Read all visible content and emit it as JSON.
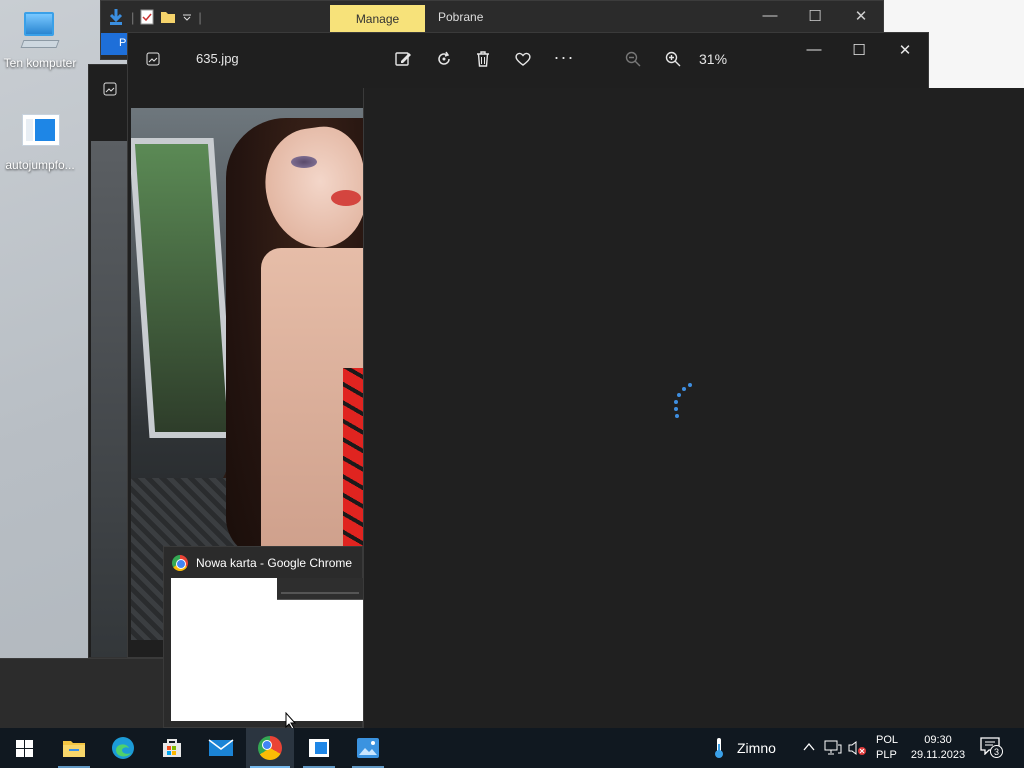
{
  "desktop": {
    "icons": [
      {
        "label": "Ten komputer"
      },
      {
        "label": "autojumpfo..."
      }
    ]
  },
  "explorer": {
    "manage_label": "Manage",
    "title": "Pobrane",
    "ribbon_tab": "Pl"
  },
  "photos": {
    "filename": "635.jpg",
    "zoom": "31%",
    "toolbar": {
      "edit_icon": "edit-image-icon",
      "rotate_icon": "rotate-icon",
      "delete_icon": "trash-icon",
      "favorite_icon": "heart-icon",
      "more_label": "···",
      "zoom_out_icon": "zoom-out-icon",
      "zoom_in_icon": "zoom-in-icon"
    }
  },
  "chrome_thumbnail": {
    "title": "Nowa karta - Google Chrome"
  },
  "taskbar": {
    "weather": "Zimno",
    "lang_line1": "POL",
    "lang_line2": "PLP",
    "time": "09:30",
    "date": "29.11.2023",
    "notifications_count": "3"
  },
  "colors": {
    "accent": "#3e8ee0",
    "manage_tab": "#f7e27a",
    "taskbar": "#101820"
  }
}
